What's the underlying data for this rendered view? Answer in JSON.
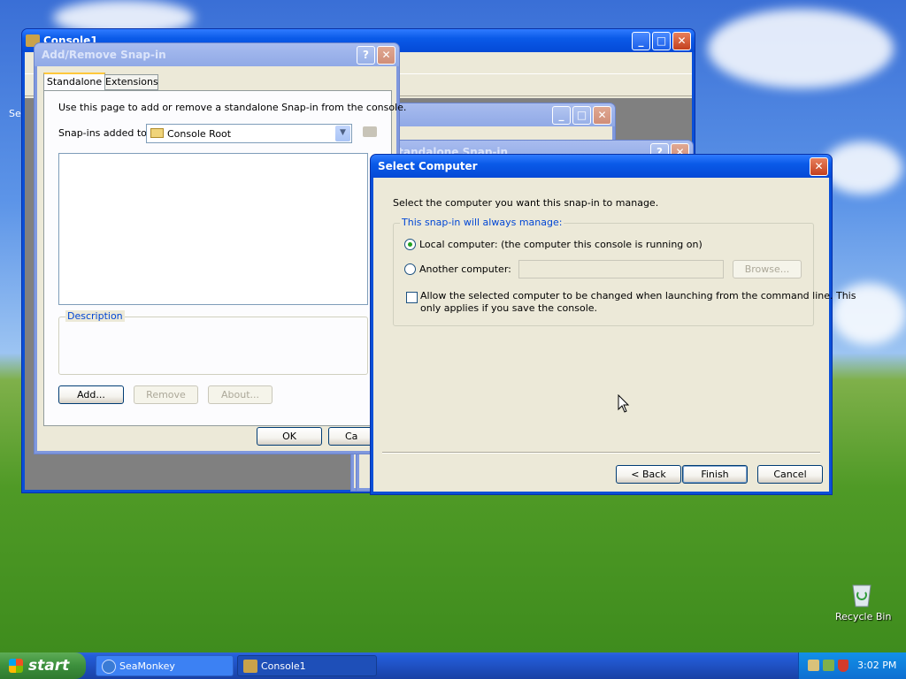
{
  "console_window": {
    "title": "Console1"
  },
  "behind_window": {
    "title": ""
  },
  "add_standalone_window": {
    "title": "Add Standalone Snap-in"
  },
  "add_remove": {
    "title": "Add/Remove Snap-in",
    "tabs": [
      "Standalone",
      "Extensions"
    ],
    "instruction": "Use this page to add or remove a standalone Snap-in from the console.",
    "snapins_label": "Snap-ins added to:",
    "snapins_value": "Console Root",
    "description_label": "Description",
    "buttons": {
      "add": "Add...",
      "remove": "Remove",
      "about": "About...",
      "ok": "OK",
      "cancel": "Ca"
    }
  },
  "select_computer": {
    "title": "Select Computer",
    "prompt": "Select the computer you want this snap-in to manage.",
    "group_label": "This snap-in will always manage:",
    "local_label": "Local computer:  (the computer this console is running on)",
    "another_label": "Another computer:",
    "another_value": "",
    "browse": "Browse...",
    "allow_line1": "Allow the selected computer to be changed when launching from the command line.  This",
    "allow_line2": "only applies if you save the console.",
    "local_selected": true,
    "allow_checked": false,
    "buttons": {
      "back": "< Back",
      "finish": "Finish",
      "cancel": "Cancel"
    }
  },
  "desktop": {
    "recycle_bin": "Recycle Bin",
    "partial_left": "Se"
  },
  "taskbar": {
    "start": "start",
    "items": [
      {
        "label": "SeaMonkey",
        "active": false
      },
      {
        "label": "Console1",
        "active": true
      }
    ],
    "clock": "3:02 PM"
  },
  "colors": {
    "title_active": "#0a5ae8",
    "face": "#ece9d8",
    "accent_blue": "#0046d5",
    "taskbar": "#245edb"
  }
}
